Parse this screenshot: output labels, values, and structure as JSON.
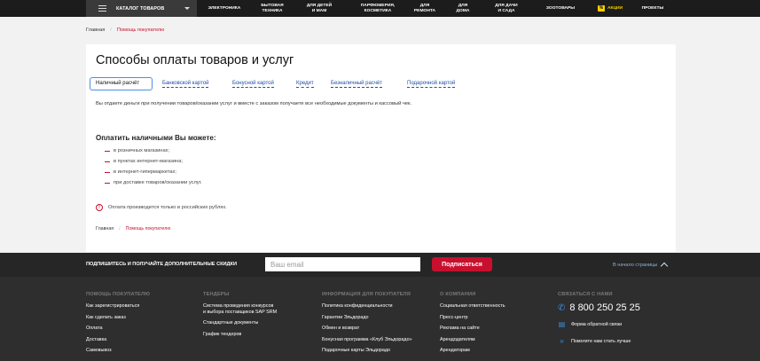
{
  "nav": {
    "catalog_label": "КАТАЛОГ ТОВАРОВ",
    "items": [
      {
        "label": "ЭЛЕКТРОНИКА"
      },
      {
        "label": "БЫТОВАЯ\nТЕХНИКА"
      },
      {
        "label": "ДЛЯ ДЕТЕЙ\nИ МАМ"
      },
      {
        "label": "ПАРФЮМЕРИЯ,\nКОСМЕТИКА"
      },
      {
        "label": "ДЛЯ\nРЕМОНТА"
      },
      {
        "label": "ДЛЯ\nДОМА"
      },
      {
        "label": "ДЛЯ ДАЧИ\nИ САДА"
      },
      {
        "label": "ЗООТОВАРЫ"
      },
      {
        "label": "АКЦИИ",
        "badge": "%"
      },
      {
        "label": "ПРОЕКТЫ"
      }
    ]
  },
  "breadcrumb": {
    "home": "Главная",
    "separator": "/",
    "current": "Помощь покупателю"
  },
  "page": {
    "title": "Способы оплаты товаров и услуг",
    "tabs": [
      {
        "label": "Наличный расчёт",
        "active": true
      },
      {
        "label": "Банковской картой"
      },
      {
        "label": "Бонусной картой"
      },
      {
        "label": "Кредит"
      },
      {
        "label": "Безналичный расчёт"
      },
      {
        "label": "Подарочной картой"
      }
    ],
    "intro": "Вы отдаете деньги при получении товаров/оказании услуг и вместе с заказом получаете все необходимые документы и кассовый чек.",
    "subheading": "Оплатить наличными Вы можете:",
    "options": [
      "в розничных магазинах;",
      "в пунктах интернет-магазина;",
      "в интернет-гипермаркетах;",
      "при доставке товаров/оказании услуг."
    ],
    "note": "Оплата производится только в российских рублях.",
    "note_icon": "exclamation-circle-icon"
  },
  "subscribe": {
    "label": "ПОДПИШИТЕСЬ И ПОЛУЧАЙТЕ ДОПОЛНИТЕЛЬНЫЕ СКИДКИ",
    "placeholder": "Ваш email",
    "button": "Подписаться",
    "to_top": "В начало страницы"
  },
  "footer": {
    "columns": [
      {
        "heading": "ПОМОЩЬ ПОКУПАТЕЛЮ",
        "links": [
          "Как зарегистрироваться",
          "Как сделать заказ",
          "Оплата",
          "Доставка",
          "Самовывоз"
        ]
      },
      {
        "heading": "ТЕНДЕРЫ",
        "links": [
          "Система проведения конкурсов\nи выбора поставщиков SAP SRM",
          "Стандартные документы",
          "График тендеров"
        ]
      },
      {
        "heading": "ИНФОРМАЦИЯ ДЛЯ ПОКУПАТЕЛЯ",
        "links": [
          "Политика конфиденциальности",
          "Гарантии Эльдорадо",
          "Обмен и возврат",
          "Бонусная программа «Клуб Эльдорадо»",
          "Подарочные карты Эльдорадо"
        ]
      },
      {
        "heading": "О КОМПАНИИ",
        "links": [
          "Социальная ответственность",
          "Пресс-центр",
          "Реклама на сайте",
          "Арендодателям",
          "Арендаторам"
        ]
      }
    ],
    "contact": {
      "heading": "СВЯЗАТЬСЯ С НАМИ",
      "phone": "8 800 250 25 25",
      "feedback": "Форма обратной связи",
      "improve": "Помогите нам стать лучше"
    }
  },
  "colors": {
    "accent_red": "#c8102e",
    "link_blue": "#1f4fa5",
    "nav_bg": "#1c1c1c",
    "promo_yellow": "#f5d000"
  }
}
